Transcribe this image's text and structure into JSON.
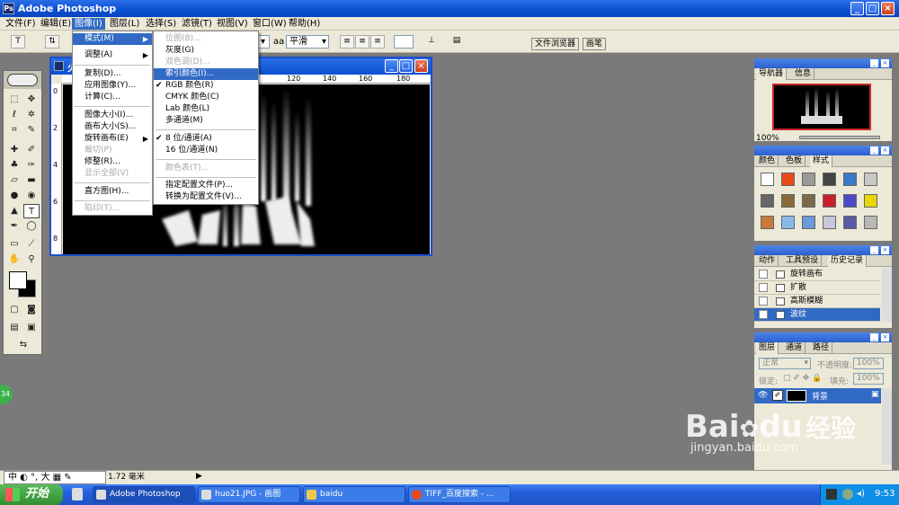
{
  "app": {
    "title": "Adobe Photoshop",
    "icon": "photoshop-icon"
  },
  "window_controls": {
    "minimize": "_",
    "maximize": "□",
    "close": "×"
  },
  "menubar": [
    {
      "label": "文件(F)"
    },
    {
      "label": "编辑(E)"
    },
    {
      "label": "图像(I)"
    },
    {
      "label": "图层(L)"
    },
    {
      "label": "选择(S)"
    },
    {
      "label": "滤镜(T)"
    },
    {
      "label": "视图(V)"
    },
    {
      "label": "窗口(W)"
    },
    {
      "label": "帮助(H)"
    }
  ],
  "options": {
    "tool_label": "T",
    "antialias_label": "aa",
    "antialias_value": "平滑",
    "palette_well_tabs": [
      "文件浏览器",
      "画笔"
    ]
  },
  "document": {
    "title": "火",
    "ruler_h": [
      "120",
      "140",
      "160",
      "180"
    ],
    "ruler_v": [
      "0",
      "2",
      "4",
      "6",
      "8"
    ]
  },
  "image_menu": {
    "items": [
      {
        "label": "模式(M)",
        "submenu": true,
        "highlight": true
      },
      {
        "label": "调整(A)",
        "submenu": true
      },
      {
        "sep": true
      },
      {
        "label": "复制(D)..."
      },
      {
        "label": "应用图像(Y)..."
      },
      {
        "label": "计算(C)..."
      },
      {
        "sep": true
      },
      {
        "label": "图像大小(I)..."
      },
      {
        "label": "画布大小(S)..."
      },
      {
        "label": "旋转画布(E)",
        "submenu": true
      },
      {
        "label": "裁切(P)",
        "disabled": true
      },
      {
        "label": "修整(R)..."
      },
      {
        "label": "显示全部(V)",
        "disabled": true
      },
      {
        "sep": true
      },
      {
        "label": "直方图(H)..."
      },
      {
        "sep": true
      },
      {
        "label": "陷印(T)...",
        "disabled": true
      }
    ]
  },
  "mode_submenu": {
    "items": [
      {
        "label": "位图(B)...",
        "disabled": true
      },
      {
        "label": "灰度(G)"
      },
      {
        "label": "双色调(D)...",
        "disabled": true
      },
      {
        "label": "索引颜色(I)...",
        "highlight": true
      },
      {
        "label": "RGB 颜色(R)",
        "checked": true
      },
      {
        "label": "CMYK 颜色(C)"
      },
      {
        "label": "Lab 颜色(L)"
      },
      {
        "label": "多通道(M)"
      },
      {
        "sep": true
      },
      {
        "label": "8 位/通道(A)",
        "checked": true
      },
      {
        "label": "16 位/通道(N)"
      },
      {
        "sep": true
      },
      {
        "label": "颜色表(T)...",
        "disabled": true
      },
      {
        "sep": true
      },
      {
        "label": "指定配置文件(P)..."
      },
      {
        "label": "转换为配置文件(V)..."
      }
    ]
  },
  "navigator": {
    "tabs": [
      "导航器",
      "信息"
    ],
    "zoom": "100%"
  },
  "color_panel": {
    "tabs": [
      "颜色",
      "色板",
      "样式"
    ],
    "style_colors": [
      "#ffffff",
      "#e84a1a",
      "#9a9a9a",
      "#444444",
      "#3a7ac8",
      "#c8c8c8",
      "#666666",
      "#8a6a3a",
      "#7a6a4a",
      "#c8202a",
      "#4a4ac8",
      "#e8d800",
      "#c87a3a",
      "#8ab8e8",
      "#6a9ad8",
      "#c8c8d8",
      "#5a5aa8",
      "#b8b8b8"
    ]
  },
  "history_panel": {
    "tabs": [
      "动作",
      "工具预设",
      "历史记录"
    ],
    "items": [
      {
        "label": "旋转画布"
      },
      {
        "label": "扩散"
      },
      {
        "label": "高斯模糊"
      },
      {
        "label": "波纹",
        "active": true
      }
    ]
  },
  "layers_panel": {
    "tabs": [
      "图层",
      "通道",
      "路径"
    ],
    "blend_mode": "正常",
    "opacity_label": "不透明度:",
    "opacity_value": "100%",
    "lock_label": "锁定:",
    "fill_label": "填充:",
    "fill_value": "100%",
    "layer_name": "背景"
  },
  "statusbar": {
    "zoom_value": "1.72 毫米",
    "ime_text": "中",
    "ime_big": "大"
  },
  "taskbar": {
    "start_label": "开始",
    "tasks": [
      {
        "label": "Adobe Photoshop",
        "active": true
      },
      {
        "label": "huo21.JPG - 画图"
      },
      {
        "label": "baidu"
      },
      {
        "label": "TIFF_百度搜索 - ..."
      }
    ],
    "clock": "9:53"
  },
  "watermark": {
    "brand": "Bai",
    "brand2": "du",
    "text": "经验",
    "url": "jingyan.baidu.com"
  },
  "side_badge": "34"
}
